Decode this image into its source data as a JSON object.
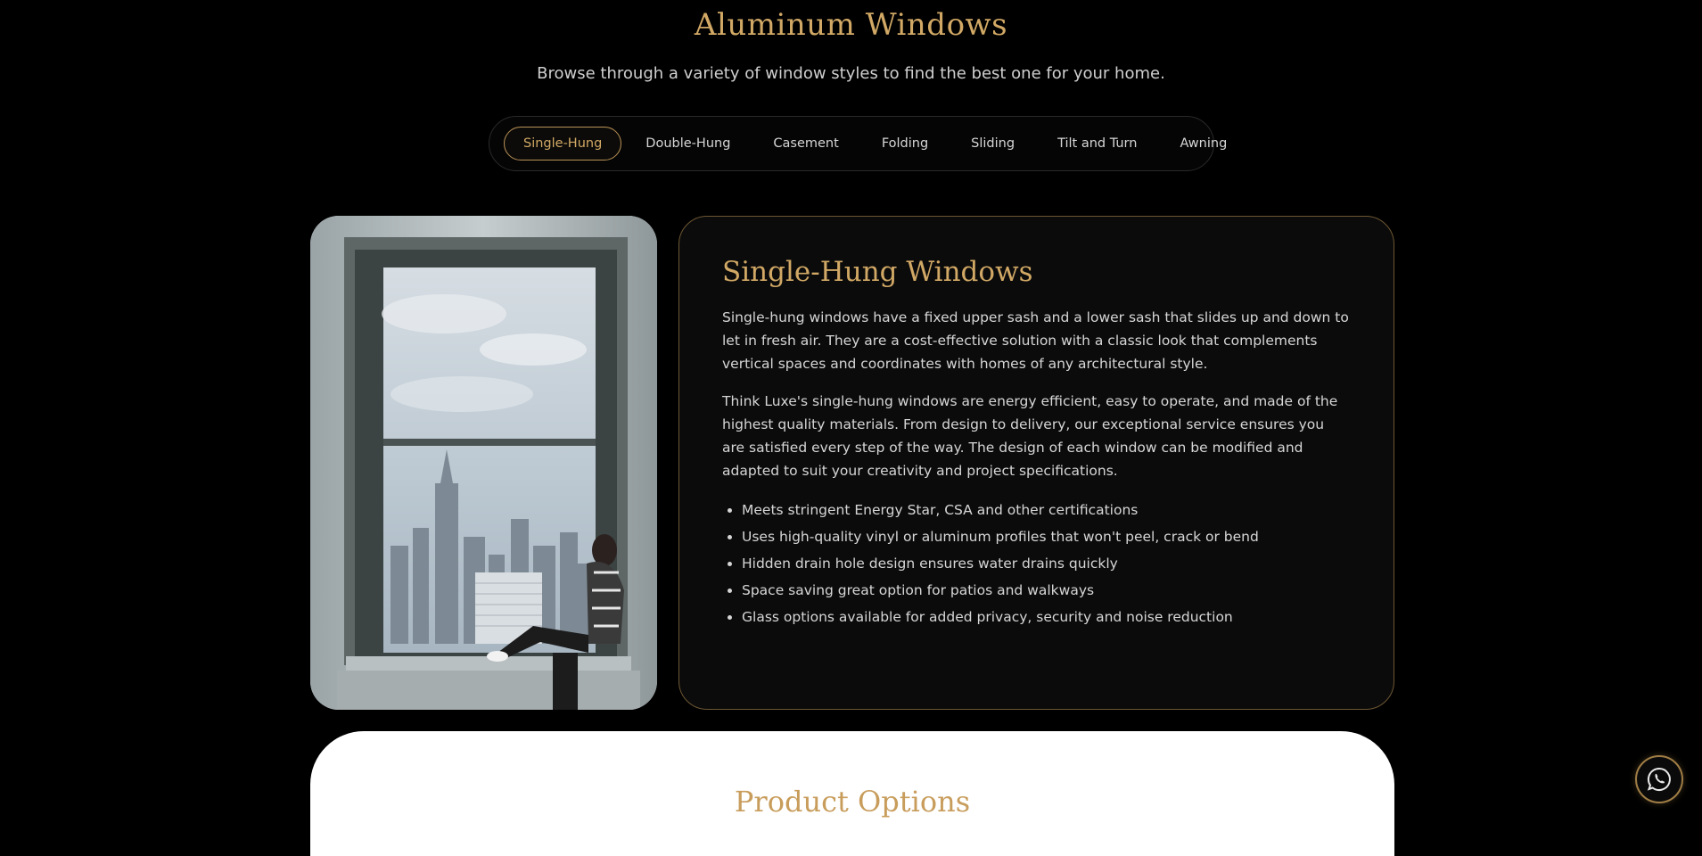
{
  "header": {
    "title": "Aluminum Windows",
    "subtitle": "Browse through a variety of window styles to find the best one for your home."
  },
  "tabs": [
    {
      "label": "Single-Hung",
      "active": true
    },
    {
      "label": "Double-Hung",
      "active": false
    },
    {
      "label": "Casement",
      "active": false
    },
    {
      "label": "Folding",
      "active": false
    },
    {
      "label": "Sliding",
      "active": false
    },
    {
      "label": "Tilt and Turn",
      "active": false
    },
    {
      "label": "Awning",
      "active": false
    }
  ],
  "detail": {
    "title": "Single-Hung Windows",
    "paragraphs": [
      "Single-hung windows have a fixed upper sash and a lower sash that slides up and down to let in fresh air. They are a cost-effective solution with a classic look that complements vertical spaces and coordinates with homes of any architectural style.",
      "Think Luxe's single-hung windows are energy efficient, easy to operate, and made of the highest quality materials. From design to delivery, our exceptional service ensures you are satisfied every step of the way. The design of each window can be modified and adapted to suit your creativity and project specifications."
    ],
    "features": [
      "Meets stringent Energy Star, CSA and other certifications",
      "Uses high-quality vinyl or aluminum profiles that won't peel, crack or bend",
      "Hidden drain hole design ensures water drains quickly",
      "Space saving great option for patios and walkways",
      "Glass options available for added privacy, security and noise reduction"
    ]
  },
  "product_options": {
    "title": "Product Options"
  },
  "floating": {
    "icon": "whatsapp-icon"
  },
  "colors": {
    "accent": "#d1a865",
    "background": "#000000",
    "card": "#0b0b0b"
  }
}
